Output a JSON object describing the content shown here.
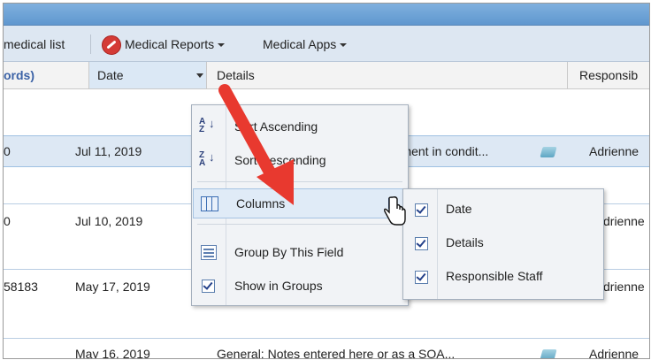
{
  "toolbar": {
    "medical_list_label": "medical list",
    "medical_reports_label": "Medical Reports",
    "medical_apps_label": "Medical Apps"
  },
  "grid": {
    "columns": [
      {
        "label": "ords)"
      },
      {
        "label": "Date"
      },
      {
        "label": "Details"
      },
      {
        "label": "Responsib"
      }
    ],
    "rows": [
      {
        "id": "0",
        "date": "Jul 11, 2019",
        "details": "rement in condit...",
        "staff": "Adrienne",
        "selected": true
      },
      {
        "id": "0",
        "date": "Jul 10, 2019",
        "details": "",
        "staff": "drienne",
        "selected": false
      },
      {
        "id": "58183",
        "date": "May 17, 2019",
        "details": "",
        "staff": "drienne",
        "selected": false
      },
      {
        "id": "",
        "date": "May 16, 2019",
        "details": "General: Notes entered here or as a SOA...",
        "staff": "Adrienne",
        "selected": false
      }
    ]
  },
  "context_menu": {
    "items": [
      {
        "label": "Sort Ascending",
        "icon": "sort-ascending-icon"
      },
      {
        "label": "Sort Descending",
        "icon": "sort-descending-icon"
      },
      {
        "label": "Columns",
        "icon": "columns-icon"
      },
      {
        "label": "Group By This Field",
        "icon": "group-by-icon"
      },
      {
        "label": "Show in Groups",
        "icon": "checkbox-checked-icon"
      }
    ]
  },
  "columns_submenu": {
    "items": [
      {
        "label": "Date",
        "checked": true
      },
      {
        "label": "Details",
        "checked": true
      },
      {
        "label": "Responsible Staff",
        "checked": true
      }
    ]
  },
  "colors": {
    "arrow": "#e8392f",
    "titlebar": "#6ea3d6",
    "selected_row": "#dde8f4"
  }
}
